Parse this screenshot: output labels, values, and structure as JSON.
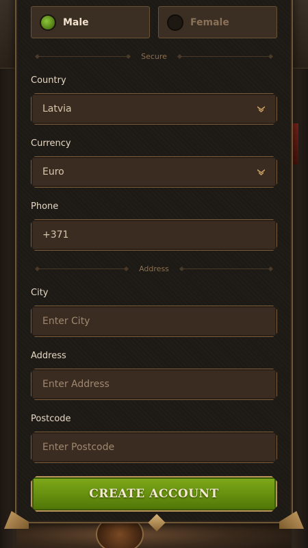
{
  "gender": {
    "male_label": "Male",
    "female_label": "Female",
    "selected": "male"
  },
  "sections": {
    "secure": "Secure",
    "address": "Address"
  },
  "fields": {
    "country": {
      "label": "Country",
      "value": "Latvia"
    },
    "currency": {
      "label": "Currency",
      "value": "Euro"
    },
    "phone": {
      "label": "Phone",
      "value": "+371"
    },
    "city": {
      "label": "City",
      "placeholder": "Enter City"
    },
    "address": {
      "label": "Address",
      "placeholder": "Enter Address"
    },
    "postcode": {
      "label": "Postcode",
      "placeholder": "Enter Postcode"
    }
  },
  "submit": {
    "label": "CREATE ACCOUNT"
  },
  "icons": {
    "select_chevron": "chevron-down-icon",
    "radio_checked": "radio-checked-icon",
    "radio_unchecked": "radio-unchecked-icon"
  },
  "colors": {
    "accent_green": "#6a9410",
    "panel_bg": "#1d1915",
    "field_bg": "#3a2c21",
    "border_gold": "#7a5c3a"
  }
}
